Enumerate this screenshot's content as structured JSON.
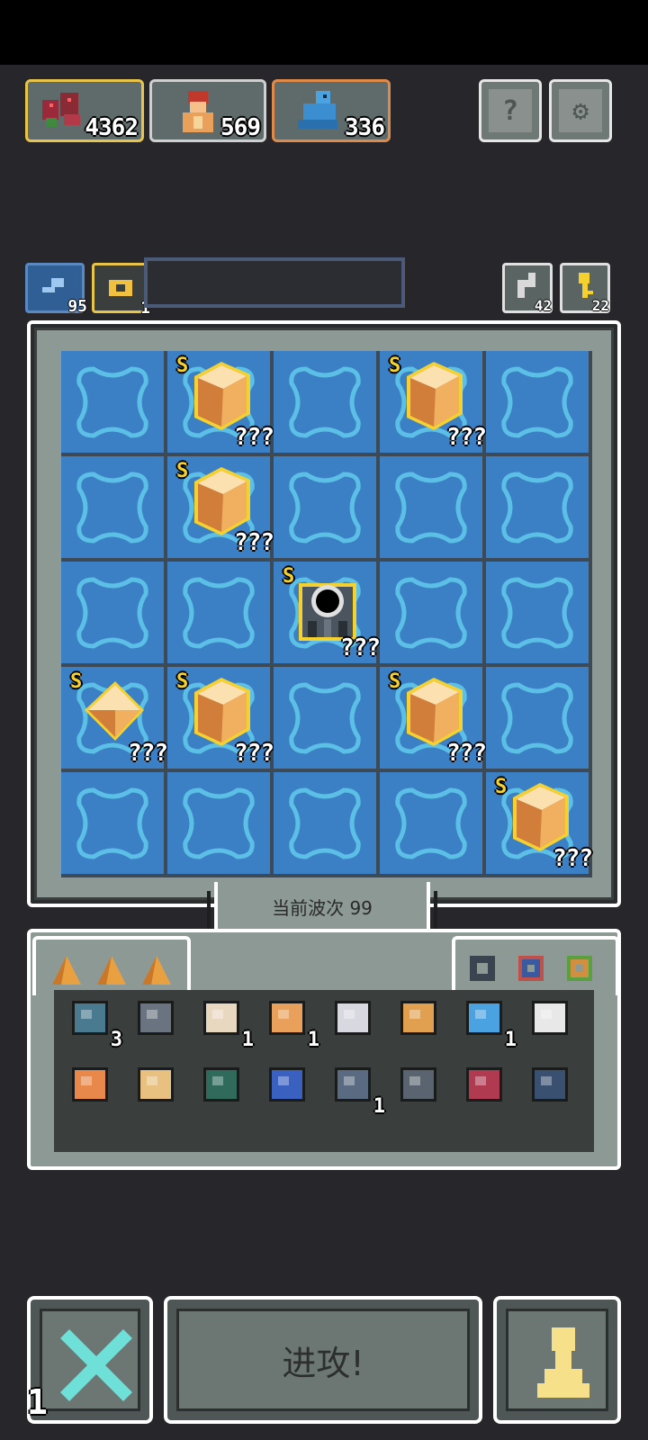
{
  "resources": [
    {
      "name": "monsters",
      "value": "4362",
      "border": "#e8c44a"
    },
    {
      "name": "warrior",
      "value": "569",
      "border": "#d8d8d8"
    },
    {
      "name": "beast",
      "value": "336",
      "border": "#e08a4a"
    }
  ],
  "top_buttons": {
    "help_glyph": "?",
    "settings_glyph": "⚙"
  },
  "sub_bar": {
    "speed_value": "95",
    "token_value": "1",
    "refresh_value": "42",
    "key_value": "22"
  },
  "board": {
    "rows": 5,
    "cols": 5,
    "units": [
      {
        "row": 0,
        "col": 1,
        "type": "crystal",
        "rank": "S",
        "label": "???"
      },
      {
        "row": 0,
        "col": 3,
        "type": "crystal",
        "rank": "S",
        "label": "???"
      },
      {
        "row": 1,
        "col": 1,
        "type": "crystal",
        "rank": "S",
        "label": "???"
      },
      {
        "row": 2,
        "col": 2,
        "type": "portal",
        "rank": "S",
        "label": "???"
      },
      {
        "row": 3,
        "col": 0,
        "type": "gem",
        "rank": "S",
        "label": "???"
      },
      {
        "row": 3,
        "col": 1,
        "type": "crystal",
        "rank": "S",
        "label": "???"
      },
      {
        "row": 3,
        "col": 3,
        "type": "crystal",
        "rank": "S",
        "label": "???"
      },
      {
        "row": 4,
        "col": 4,
        "type": "crystal",
        "rank": "S",
        "label": "???"
      }
    ]
  },
  "wave_label": "当前波次 99",
  "inventory": {
    "row1": [
      {
        "name": "heart-armor-icon",
        "count": "3"
      },
      {
        "name": "shield-icon",
        "count": ""
      },
      {
        "name": "lantern-icon",
        "count": "1"
      },
      {
        "name": "warrior-bust-icon",
        "count": "1"
      },
      {
        "name": "battle-axe-icon",
        "count": ""
      },
      {
        "name": "ring-frame-icon",
        "count": ""
      },
      {
        "name": "staff-icon",
        "count": "1"
      },
      {
        "name": "boot-icon",
        "count": ""
      }
    ],
    "row2": [
      {
        "name": "pumpkin-cart-icon",
        "count": ""
      },
      {
        "name": "ship-icon",
        "count": ""
      },
      {
        "name": "gate-icon",
        "count": ""
      },
      {
        "name": "potion-cauldron-icon",
        "count": ""
      },
      {
        "name": "wall-axe-icon",
        "count": "1"
      },
      {
        "name": "flower-rock-icon",
        "count": ""
      },
      {
        "name": "demon-icon",
        "count": ""
      },
      {
        "name": "stone-wolf-icon",
        "count": ""
      }
    ]
  },
  "bottom": {
    "cancel_count": "1",
    "attack_label": "进攻!"
  },
  "colors": {
    "water": "#3b7fc5",
    "crystal": "#e8a05a",
    "rank_gold": "#f5d130"
  }
}
